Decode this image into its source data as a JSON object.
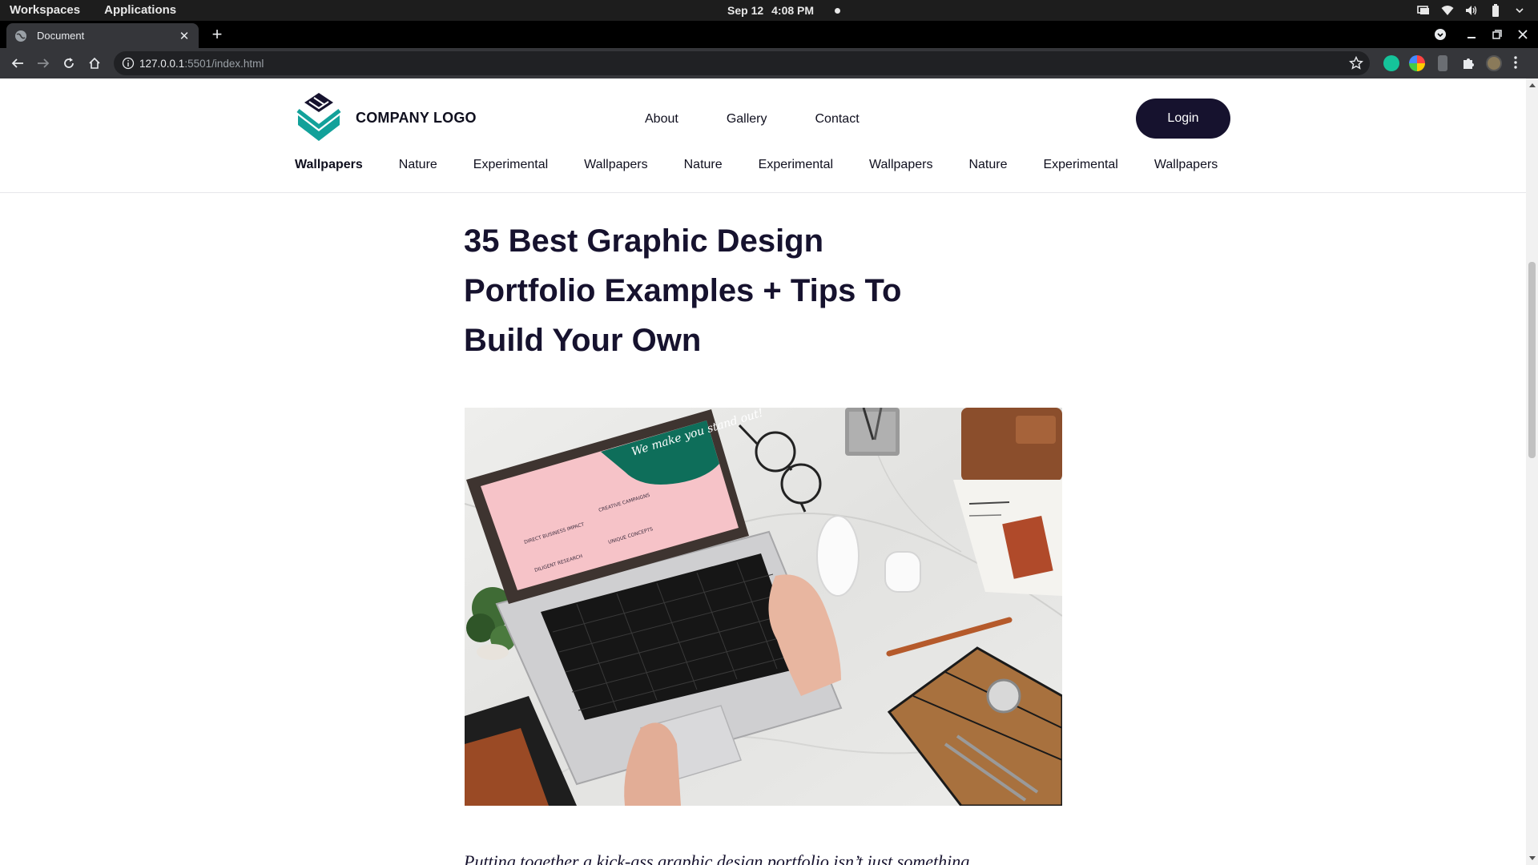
{
  "os": {
    "workspaces": "Workspaces",
    "applications": "Applications",
    "date": "Sep 12",
    "time": "4:08 PM"
  },
  "browser": {
    "tab_title": "Document",
    "url_host": "127.0.0.1",
    "url_path": ":5501/index.html"
  },
  "site": {
    "logo_text": "COMPANY LOGO",
    "nav": [
      "About",
      "Gallery",
      "Contact"
    ],
    "login_label": "Login",
    "categories": [
      "Wallpapers",
      "Nature",
      "Experimental",
      "Wallpapers",
      "Nature",
      "Experimental",
      "Wallpapers",
      "Nature",
      "Experimental",
      "Wallpapers"
    ],
    "active_category": "Wallpapers"
  },
  "article": {
    "title_lines": [
      "35 Best Graphic Design",
      "Portfolio Examples + Tips To",
      "Build Your Own"
    ],
    "hero": {
      "screen_heading": "We make you stand out!",
      "screen_items": [
        "DIRECT BUSINESS IMPACT",
        "CREATIVE CAMPAIGNS",
        "DILIGENT RESEARCH",
        "UNIQUE CONCEPTS"
      ]
    },
    "lead": "Putting together a kick-ass graphic design portfolio isn’t just something"
  },
  "colors": {
    "brand_dark": "#16122e",
    "logo_teal": "#12a19a",
    "laptop_screen_green": "#0e6e5a",
    "laptop_screen_pink": "#f6c3c8"
  }
}
